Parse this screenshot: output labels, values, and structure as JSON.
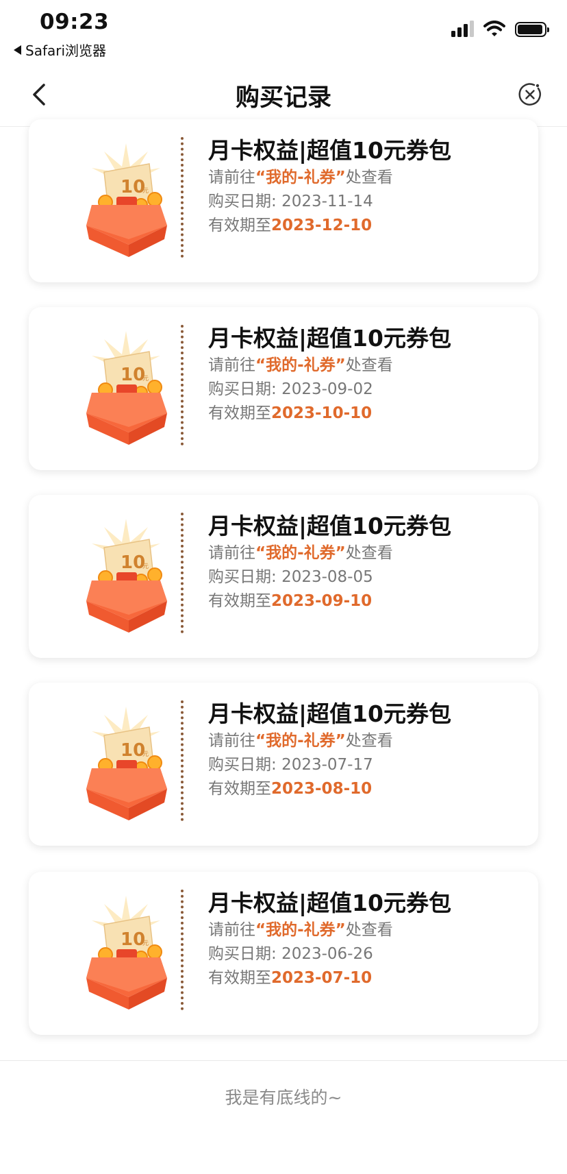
{
  "status_bar": {
    "time": "09:23",
    "back_app": "Safari浏览器",
    "icons": [
      "signal-icon",
      "wifi-icon",
      "battery-icon"
    ]
  },
  "nav": {
    "title": "购买记录",
    "back_icon": "chevron-left-icon",
    "close_icon": "close-circle-icon"
  },
  "colors": {
    "accent": "#E06A2C",
    "box": "#F26B3F",
    "divider": "#8A5A38"
  },
  "records": [
    {
      "title": "月卡权益|超值10元券包",
      "hint_prefix": "请前往",
      "hint_link": "“我的-礼券”",
      "hint_suffix": "处查看",
      "purchase_label": "购买日期: ",
      "purchase_date": "2023-11-14",
      "valid_label": "有效期至",
      "valid_date": "2023-12-10",
      "coupon_value": "10",
      "coupon_unit": "元"
    },
    {
      "title": "月卡权益|超值10元券包",
      "hint_prefix": "请前往",
      "hint_link": "“我的-礼券”",
      "hint_suffix": "处查看",
      "purchase_label": "购买日期: ",
      "purchase_date": "2023-09-02",
      "valid_label": "有效期至",
      "valid_date": "2023-10-10",
      "coupon_value": "10",
      "coupon_unit": "元"
    },
    {
      "title": "月卡权益|超值10元券包",
      "hint_prefix": "请前往",
      "hint_link": "“我的-礼券”",
      "hint_suffix": "处查看",
      "purchase_label": "购买日期: ",
      "purchase_date": "2023-08-05",
      "valid_label": "有效期至",
      "valid_date": "2023-09-10",
      "coupon_value": "10",
      "coupon_unit": "元"
    },
    {
      "title": "月卡权益|超值10元券包",
      "hint_prefix": "请前往",
      "hint_link": "“我的-礼券”",
      "hint_suffix": "处查看",
      "purchase_label": "购买日期: ",
      "purchase_date": "2023-07-17",
      "valid_label": "有效期至",
      "valid_date": "2023-08-10",
      "coupon_value": "10",
      "coupon_unit": "元"
    },
    {
      "title": "月卡权益|超值10元券包",
      "hint_prefix": "请前往",
      "hint_link": "“我的-礼券”",
      "hint_suffix": "处查看",
      "purchase_label": "购买日期: ",
      "purchase_date": "2023-06-26",
      "valid_label": "有效期至",
      "valid_date": "2023-07-10",
      "coupon_value": "10",
      "coupon_unit": "元"
    }
  ],
  "footer": {
    "text": "我是有底线的~"
  }
}
